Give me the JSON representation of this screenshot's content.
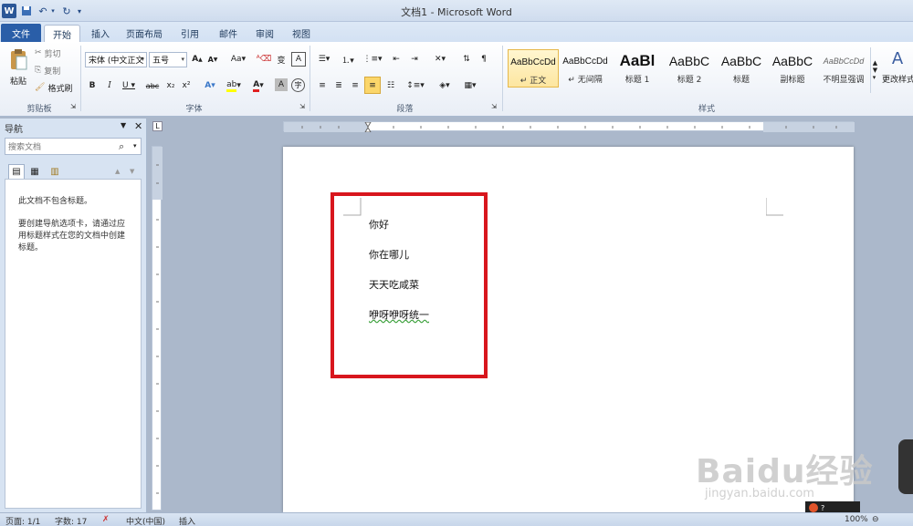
{
  "window": {
    "title": "文档1 - Microsoft Word"
  },
  "tabs": [
    "文件",
    "开始",
    "插入",
    "页面布局",
    "引用",
    "邮件",
    "审阅",
    "视图"
  ],
  "clipboard": {
    "paste": "粘贴",
    "cut": "剪切",
    "copy": "复制",
    "format_painter": "格式刷",
    "label": "剪贴板"
  },
  "font": {
    "name": "宋体 (中文正文",
    "size": "五号",
    "label": "字体"
  },
  "paragraph": {
    "label": "段落"
  },
  "styles": {
    "label": "样式",
    "items": [
      {
        "sample": "AaBbCcDd",
        "name": "↵ 正文"
      },
      {
        "sample": "AaBbCcDd",
        "name": "↵ 无间隔"
      },
      {
        "sample": "AaBl",
        "name": "标题 1"
      },
      {
        "sample": "AaBbC",
        "name": "标题 2"
      },
      {
        "sample": "AaBbC",
        "name": "标题"
      },
      {
        "sample": "AaBbC",
        "name": "副标题"
      },
      {
        "sample": "AaBbCcDd",
        "name": "不明显强调"
      }
    ],
    "change_styles": "更改样式"
  },
  "nav": {
    "title": "导航",
    "search_placeholder": "搜索文档",
    "message1": "此文档不包含标题。",
    "message2": "要创建导航选项卡，请通过应用标题样式在您的文档中创建标题。"
  },
  "document": {
    "lines": [
      "你好",
      "你在哪儿",
      "天天吃咸菜",
      "咿呀咿呀统一"
    ]
  },
  "status": {
    "page": "页面: 1/1",
    "words": "字数: 17",
    "language": "中文(中国)",
    "mode": "插入",
    "zoom": "100%"
  },
  "watermark": {
    "brand": "Baidu经验",
    "url": "jingyan.baidu.com"
  },
  "colors": {
    "file_tab": "#2a5ea8",
    "highlight_box": "#d8161d"
  }
}
